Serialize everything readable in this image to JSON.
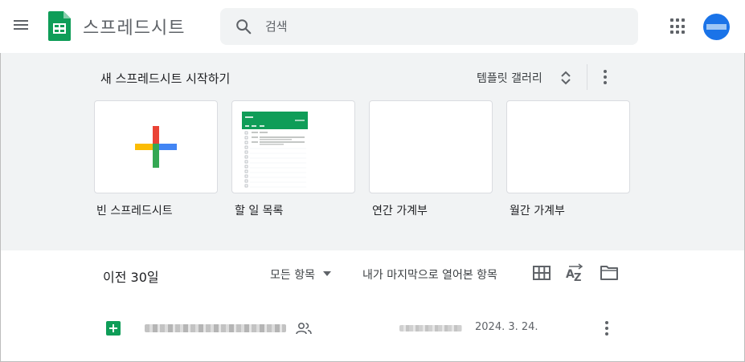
{
  "header": {
    "app_title": "스프레드시트",
    "search_placeholder": "검색",
    "menu_icon": "hamburger-menu-icon",
    "apps_icon": "google-apps-grid-icon",
    "avatar_icon": "account-avatar"
  },
  "gallery": {
    "title": "새 스프레드시트 시작하기",
    "template_gallery_label": "템플릿 갤러리",
    "templates": [
      {
        "label": "빈 스프레드시트"
      },
      {
        "label": "할 일 목록"
      },
      {
        "label": "연간 가계부"
      },
      {
        "label": "월간 가계부"
      }
    ]
  },
  "recent": {
    "heading": "이전 30일",
    "owner_filter": "모든 항목",
    "sort_label": "내가 마지막으로 열어본 항목",
    "files": [
      {
        "date": "2024. 3. 24.",
        "shared": true
      }
    ]
  },
  "colors": {
    "sheets_green": "#0f9d58",
    "avatar_blue": "#1a73e8",
    "gallery_bg": "#f1f3f4"
  }
}
